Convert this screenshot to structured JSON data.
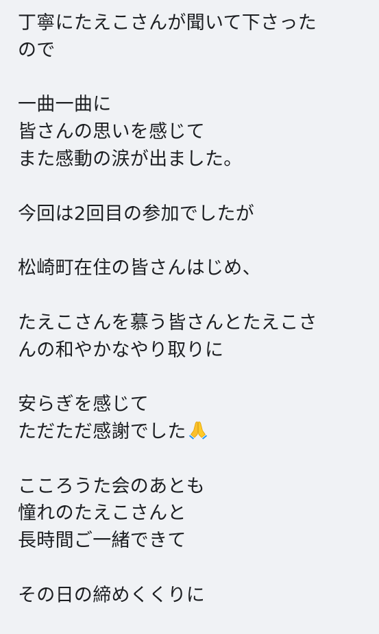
{
  "post": {
    "lines": [
      "丁寧にたえこさんが聞いて下さった",
      "ので",
      "",
      "一曲一曲に",
      "皆さんの思いを感じて",
      "また感動の涙が出ました。",
      "",
      "今回は2回目の参加でしたが",
      "",
      "松崎町在住の皆さんはじめ、",
      "",
      "たえこさんを慕う皆さんとたえこさ",
      "んの和やかなやり取りに",
      "",
      "安らぎを感じて",
      "ただただ感謝でした",
      "",
      "こころうた会のあとも",
      "憧れのたえこさんと",
      "長時間ご一緒できて",
      "",
      "その日の締めくくりに"
    ],
    "emoji_after_line_15": "folded-hands-emoji"
  }
}
